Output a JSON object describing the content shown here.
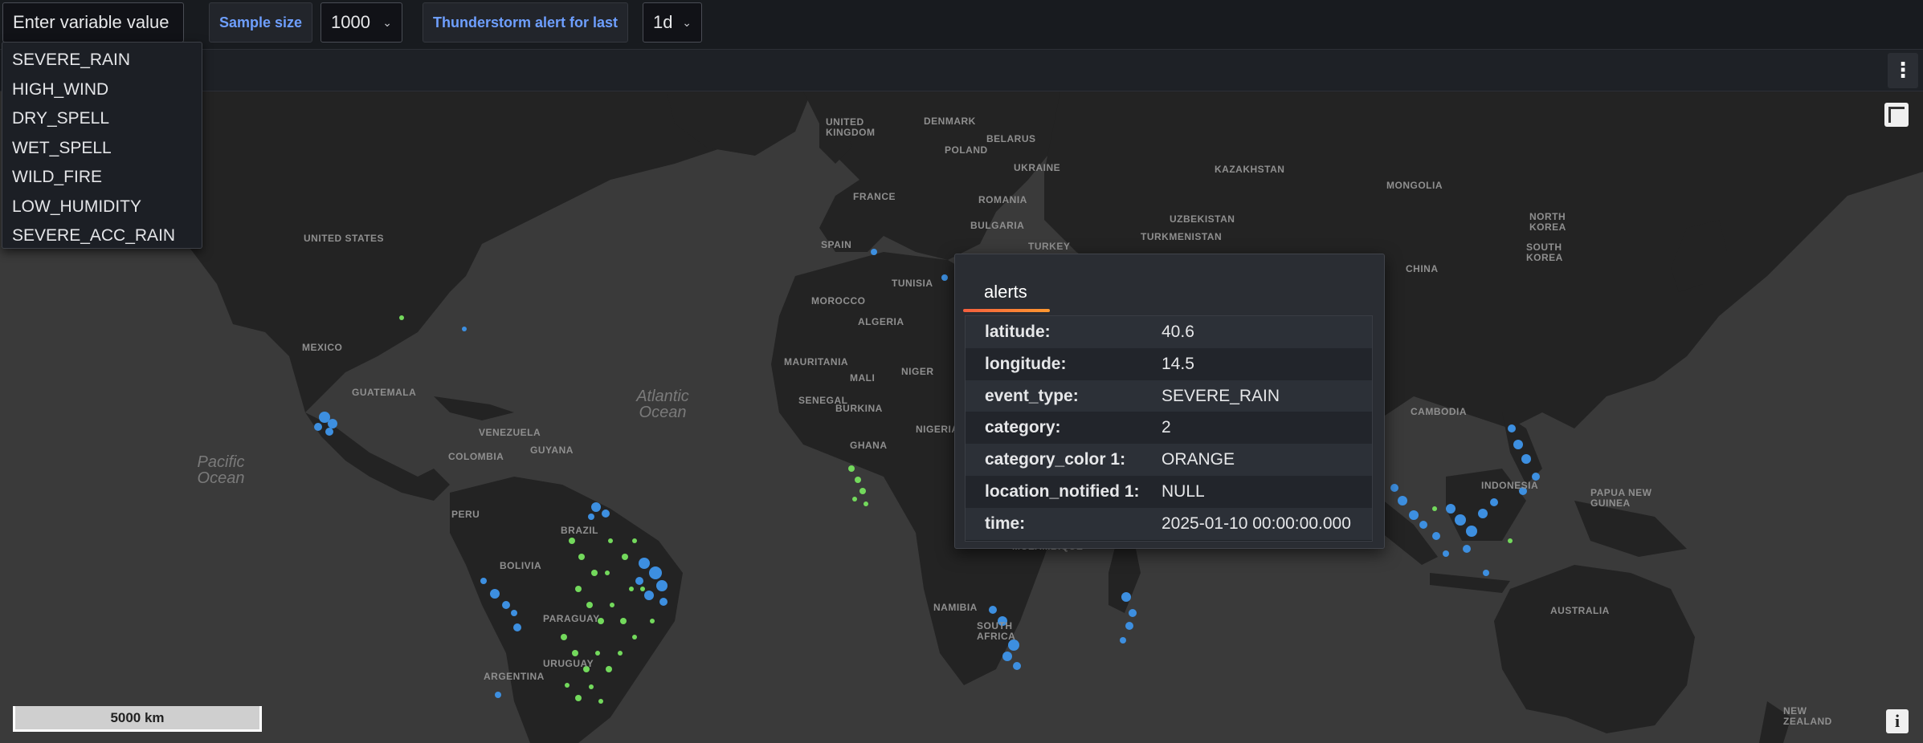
{
  "variables": {
    "input_placeholder": "Enter variable value",
    "sample_size_label": "Sample size",
    "sample_size_value": "1000",
    "thunder_label": "Thunderstorm alert for last",
    "thunder_value": "1d",
    "dropdown_options": [
      "SEVERE_RAIN",
      "HIGH_WIND",
      "DRY_SPELL",
      "WET_SPELL",
      "WILD_FIRE",
      "LOW_HUMIDITY",
      "SEVERE_ACC_RAIN"
    ]
  },
  "map": {
    "scale_label": "5000 km",
    "oceans": {
      "atlantic": "Atlantic Ocean",
      "pacific": "Pacific Ocean"
    },
    "countries": {
      "united_states": "UNITED STATES",
      "mexico": "MEXICO",
      "guatemala": "GUATEMALA",
      "venezuela": "VENEZUELA",
      "colombia": "COLOMBIA",
      "guyana": "GUYANA",
      "peru": "PERU",
      "brazil": "BRAZIL",
      "bolivia": "BOLIVIA",
      "paraguay": "PARAGUAY",
      "uruguay": "URUGUAY",
      "argentina": "ARGENTINA",
      "united_kingdom": "UNITED KINGDOM",
      "denmark": "DENMARK",
      "belarus": "BELARUS",
      "poland": "POLAND",
      "ukraine": "UKRAINE",
      "france": "FRANCE",
      "romania": "ROMANIA",
      "spain": "SPAIN",
      "bulgaria": "BULGARIA",
      "turkey": "TURKEY",
      "morocco": "MOROCCO",
      "tunisia": "TUNISIA",
      "algeria": "ALGERIA",
      "mauritania": "MAURITANIA",
      "mali": "MALI",
      "niger": "NIGER",
      "senegal": "SENEGAL",
      "burkina": "BURKINA",
      "nigeria": "NIGERIA",
      "ghana": "GHANA",
      "kazakhstan": "KAZAKHSTAN",
      "uzbekistan": "UZBEKISTAN",
      "turkmenistan": "TURKMENISTAN",
      "mongolia": "MONGOLIA",
      "china": "CHINA",
      "north_korea": "NORTH KOREA",
      "south_korea": "SOUTH KOREA",
      "cambodia": "CAMBODIA",
      "indonesia": "INDONESIA",
      "papua": "PAPUA NEW GUINEA",
      "australia": "AUSTRALIA",
      "new_zealand": "NEW ZEALAND",
      "mozambique": "MOZAMBIQUE",
      "namibia": "NAMIBIA",
      "south_africa": "SOUTH AFRICA"
    }
  },
  "tooltip": {
    "tab_label": "alerts",
    "rows": [
      {
        "key": "latitude:",
        "value": "40.6"
      },
      {
        "key": "longitude:",
        "value": "14.5"
      },
      {
        "key": "event_type:",
        "value": "SEVERE_RAIN"
      },
      {
        "key": "category:",
        "value": "2"
      },
      {
        "key": "category_color 1:",
        "value": "ORANGE"
      },
      {
        "key": "location_notified 1:",
        "value": "NULL"
      },
      {
        "key": "time:",
        "value": "2025-01-10 00:00:00.000"
      }
    ]
  },
  "colors": {
    "point_blue": "#3d8fe0",
    "point_green": "#73d95c",
    "land": "#232323",
    "water": "#3a3a3a"
  }
}
